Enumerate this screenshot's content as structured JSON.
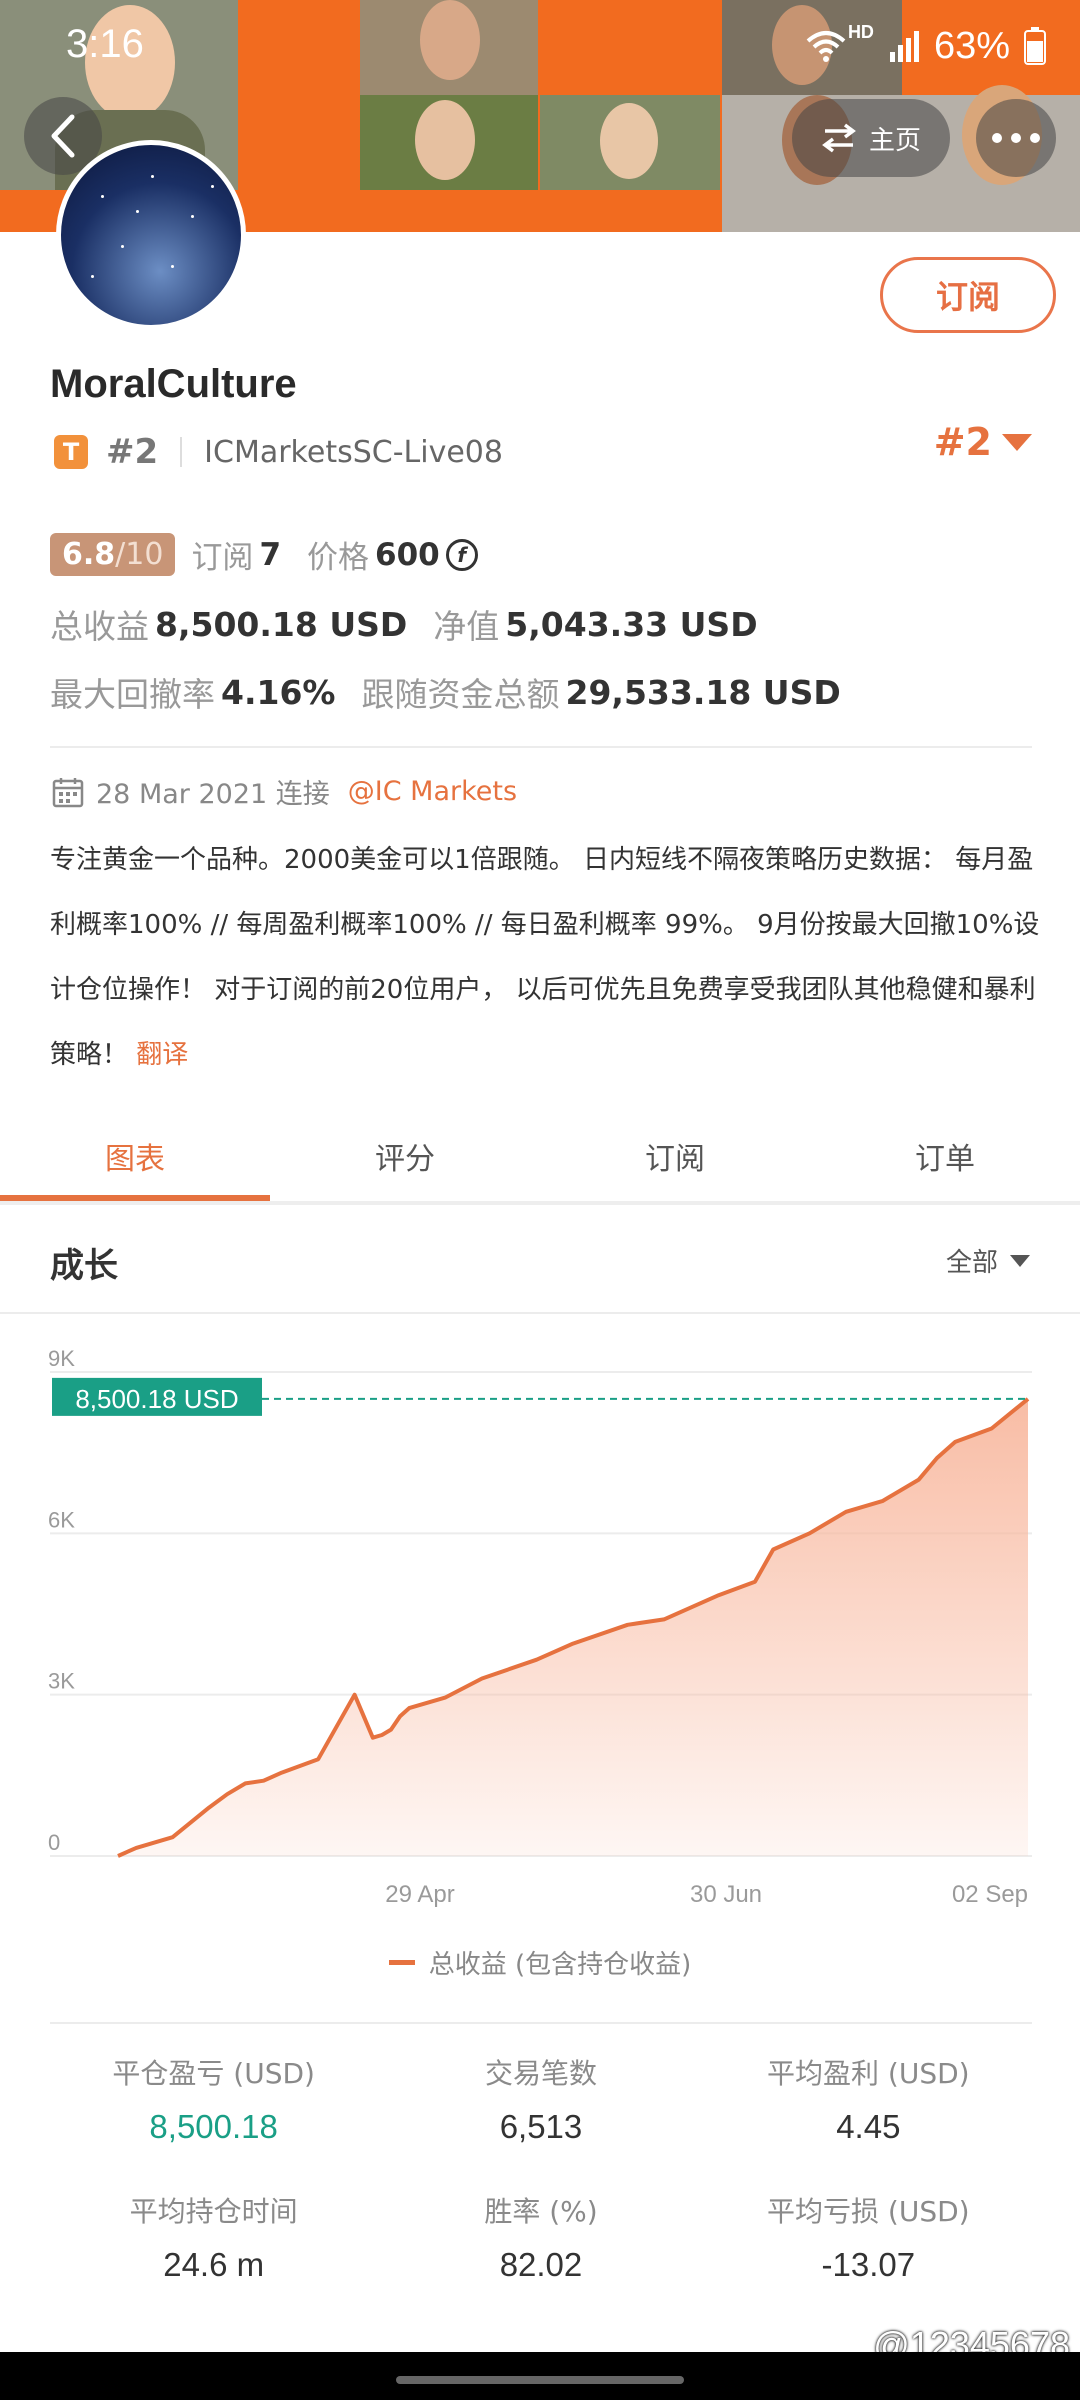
{
  "status_bar": {
    "time": "3:16",
    "network": "HD",
    "battery": "63%"
  },
  "header": {
    "home_label": "主页"
  },
  "profile": {
    "name": "MoralCulture",
    "badge": "T",
    "rank": "#2",
    "server": "ICMarketsSC-Live08",
    "rank_right": "#2",
    "subscribe_label": "订阅"
  },
  "stats": {
    "score": "6.8",
    "score_max": "/10",
    "subscriptions_label": "订阅",
    "subscriptions": "7",
    "price_label": "价格",
    "price": "600",
    "price_currency_symbol": "f",
    "total_profit_label": "总收益",
    "total_profit": "8,500.18 USD",
    "equity_label": "净值",
    "equity": "5,043.33 USD",
    "max_drawdown_label": "最大回撤率",
    "max_drawdown": "4.16%",
    "follow_funds_label": "跟随资金总额",
    "follow_funds": "29,533.18 USD"
  },
  "connection": {
    "date": "28 Mar 2021 连接",
    "broker": "@IC Markets"
  },
  "description": {
    "text": "专注黄金一个品种。2000美金可以1倍跟随。 日内短线不隔夜策略历史数据： 每月盈利概率100% // 每周盈利概率100% // 每日盈利概率 99%。 9月份按最大回撤10%设计仓位操作！ 对于订阅的前20位用户， 以后可优先且免费享受我团队其他稳健和暴利策略！",
    "translate": "翻译"
  },
  "tabs": [
    {
      "label": "图表",
      "active": true
    },
    {
      "label": "评分",
      "active": false
    },
    {
      "label": "订阅",
      "active": false
    },
    {
      "label": "订单",
      "active": false
    }
  ],
  "growth": {
    "title": "成长",
    "range_label": "全部"
  },
  "chart_data": {
    "type": "area",
    "y_ticks": [
      "9K",
      "6K",
      "3K",
      "0"
    ],
    "ylim": [
      0,
      9000
    ],
    "x_ticks": [
      "29 Apr",
      "30 Jun",
      "02 Sep"
    ],
    "current_label": "8,500.18 USD",
    "current_value": 8500.18,
    "series": [
      {
        "name": "总收益 (包含持仓收益)",
        "x_index": [
          0,
          2,
          6,
          10,
          12,
          14,
          16,
          18,
          22,
          26,
          28,
          29,
          30,
          31,
          32,
          36,
          40,
          46,
          50,
          56,
          60,
          66,
          70,
          72,
          76,
          80,
          84,
          88,
          90,
          92,
          96,
          100
        ],
        "values": [
          0,
          150,
          350,
          900,
          1150,
          1350,
          1400,
          1550,
          1800,
          3000,
          2200,
          2250,
          2350,
          2600,
          2750,
          2950,
          3300,
          3650,
          3950,
          4300,
          4400,
          4850,
          5100,
          5700,
          6000,
          6400,
          6600,
          7000,
          7400,
          7700,
          7950,
          8500
        ]
      }
    ],
    "colors": {
      "line": "#e6723f",
      "fill": "#f8b9a0",
      "marker": "#1a9f86"
    }
  },
  "metrics": [
    {
      "label": "平仓盈亏 (USD)",
      "value": "8,500.18",
      "green": true
    },
    {
      "label": "交易笔数",
      "value": "6,513",
      "green": false
    },
    {
      "label": "平均盈利 (USD)",
      "value": "4.45",
      "green": false
    },
    {
      "label": "平均持仓时间",
      "value": "24.6 m",
      "green": false
    },
    {
      "label": "胜率 (%)",
      "value": "82.02",
      "green": false
    },
    {
      "label": "平均亏损 (USD)",
      "value": "-13.07",
      "green": false
    }
  ],
  "watermark": "@12345678"
}
